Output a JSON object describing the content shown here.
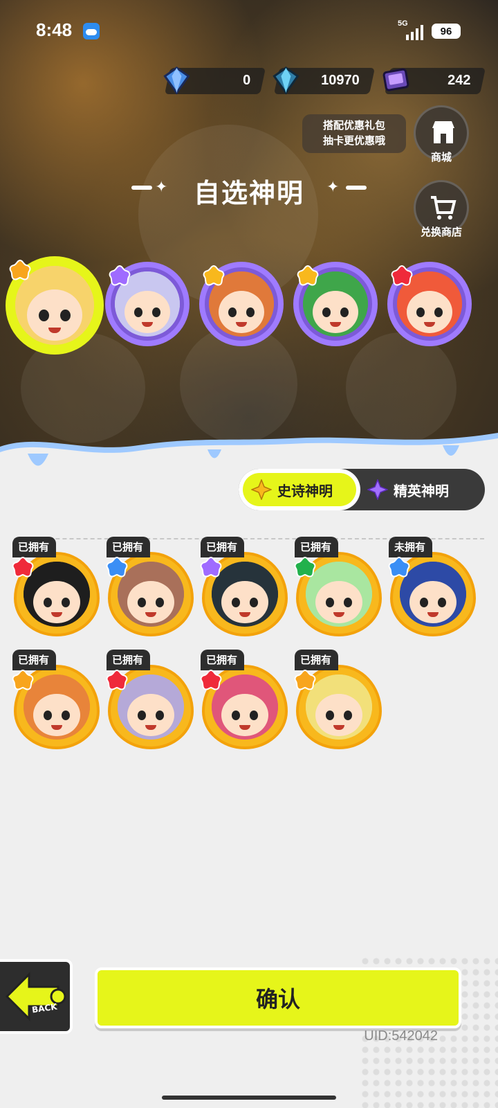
{
  "status_bar": {
    "time": "8:48",
    "network": "5G",
    "battery": "96"
  },
  "currencies": [
    {
      "icon": "gem-icon",
      "value": "0"
    },
    {
      "icon": "crystal-icon",
      "value": "10970"
    },
    {
      "icon": "ticket-icon",
      "value": "242"
    }
  ],
  "promo": {
    "line1": "搭配优惠礼包",
    "line2": "抽卡更优惠哦"
  },
  "side_buttons": {
    "shop": "商城",
    "exchange": "兑换商店"
  },
  "title": "自选神明",
  "featured": [
    {
      "icon": "avatar-blonde-icon",
      "star_color": "#f8a51d",
      "hair": "#f7d36b",
      "selected": true
    },
    {
      "icon": "avatar-silver-icon",
      "star_color": "#9f6bff",
      "hair": "#c9c7f0",
      "selected": false
    },
    {
      "icon": "avatar-orange-icon",
      "star_color": "#f8b81d",
      "hair": "#e0793a",
      "selected": false
    },
    {
      "icon": "avatar-green-cap-icon",
      "star_color": "#f8b81d",
      "hair": "#3fa64a",
      "selected": false
    },
    {
      "icon": "avatar-redhair-icon",
      "star_color": "#ef2a3a",
      "hair": "#f05a3a",
      "selected": false
    }
  ],
  "tabs": {
    "epic": "史诗神明",
    "elite": "精英神明"
  },
  "cards": [
    {
      "status": "已拥有",
      "star_color": "#ef2a3a",
      "hair": "#1e1e1e"
    },
    {
      "status": "已拥有",
      "star_color": "#3a8ef5",
      "hair": "#a9705a"
    },
    {
      "status": "已拥有",
      "star_color": "#9f6bff",
      "hair": "#26333b"
    },
    {
      "status": "已拥有",
      "star_color": "#22b14c",
      "hair": "#a9e6a0"
    },
    {
      "status": "未拥有",
      "star_color": "#3a8ef5",
      "hair": "#2d4aa6"
    },
    {
      "status": "已拥有",
      "star_color": "#f8a51d",
      "hair": "#e8843a"
    },
    {
      "status": "已拥有",
      "star_color": "#ef2a3a",
      "hair": "#b5a9d8"
    },
    {
      "status": "已拥有",
      "star_color": "#ef2a3a",
      "hair": "#e0567a"
    },
    {
      "status": "已拥有",
      "star_color": "#f8a51d",
      "hair": "#f2e07a"
    }
  ],
  "back_label": "BACK",
  "confirm_label": "确认",
  "uid": "UID:542042",
  "colors": {
    "accent": "#e6f51a",
    "card_ring": "#f8b81d",
    "dark": "#2d2d2d"
  }
}
